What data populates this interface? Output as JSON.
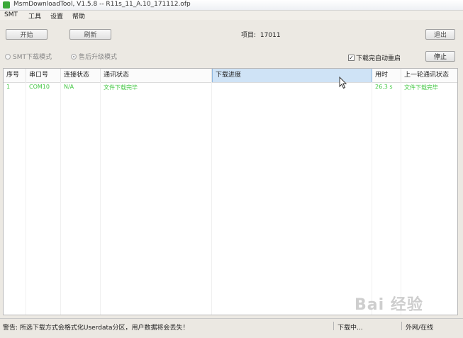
{
  "window": {
    "title": "MsmDownloadTool, V1.5.8 -- R11s_11_A.10_171112.ofp"
  },
  "menu": [
    "SMT",
    "工具",
    "设置",
    "帮助"
  ],
  "toolbar": {
    "start_label": "开始",
    "refresh_label": "刷新",
    "exit_label": "退出",
    "stop_label": "停止",
    "project_label": "项目:",
    "project_value": "17011"
  },
  "modes": {
    "smt_label": "SMT下载模式",
    "aftersale_label": "售后升级模式",
    "selected": "售后升级模式"
  },
  "auto_reboot": {
    "label": "下载完自动重启",
    "checked": true
  },
  "table": {
    "columns": [
      "序号",
      "串口号",
      "连接状态",
      "通讯状态",
      "下载进度",
      "用时",
      "上一轮通讯状态"
    ],
    "rows": [
      {
        "index": "1",
        "port": "COM10",
        "connection": "N/A",
        "comm": "文件下载完毕",
        "progress": "",
        "time": "26.3 s",
        "last_comm": "文件下载完毕"
      }
    ]
  },
  "status": {
    "warning": "警告: 所选下载方式会格式化Userdata分区，用户数据将会丢失！",
    "state": "下载中...",
    "network": "外网/在线"
  },
  "colors": {
    "success_text": "#45c845",
    "selected_header": "#cfe3f6"
  },
  "watermark": "Bai 经验"
}
